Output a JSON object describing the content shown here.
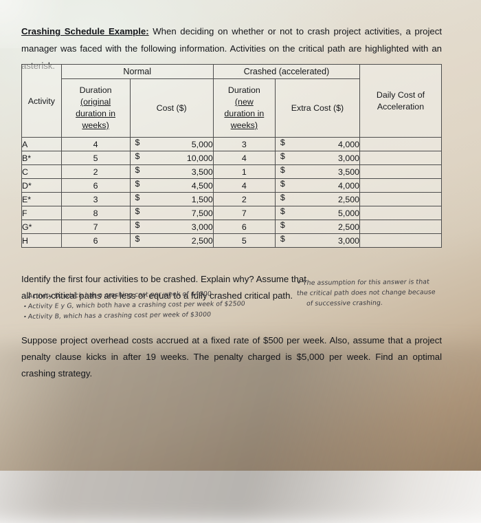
{
  "intro": {
    "lead": "Crashing Schedule Example:",
    "body": " When deciding on whether or not to crash project activities, a project manager was faced with the following information. Activities on the critical path are highlighted with an asterisk."
  },
  "table": {
    "group_headers": {
      "normal": "Normal",
      "crashed": "Crashed (accelerated)"
    },
    "columns": {
      "activity": "Activity",
      "normal_duration_line1": "Duration",
      "normal_duration_line2": "(original",
      "normal_duration_line3": "duration in",
      "normal_duration_line4": "weeks)",
      "normal_cost": "Cost ($)",
      "crashed_duration_line1": "Duration",
      "crashed_duration_line2": "(new",
      "crashed_duration_line3": "duration in",
      "crashed_duration_line4": "weeks)",
      "extra_cost": "Extra Cost ($)",
      "daily_cost_line1": "Daily Cost of",
      "daily_cost_line2": "Acceleration"
    },
    "currency_symbol": "$",
    "rows": [
      {
        "activity": "A",
        "normal_duration": "4",
        "normal_cost": "5,000",
        "crashed_duration": "3",
        "extra_cost": "4,000",
        "daily_cost": ""
      },
      {
        "activity": "B*",
        "normal_duration": "5",
        "normal_cost": "10,000",
        "crashed_duration": "4",
        "extra_cost": "3,000",
        "daily_cost": ""
      },
      {
        "activity": "C",
        "normal_duration": "2",
        "normal_cost": "3,500",
        "crashed_duration": "1",
        "extra_cost": "3,500",
        "daily_cost": ""
      },
      {
        "activity": "D*",
        "normal_duration": "6",
        "normal_cost": "4,500",
        "crashed_duration": "4",
        "extra_cost": "4,000",
        "daily_cost": ""
      },
      {
        "activity": "E*",
        "normal_duration": "3",
        "normal_cost": "1,500",
        "crashed_duration": "2",
        "extra_cost": "2,500",
        "daily_cost": ""
      },
      {
        "activity": "F",
        "normal_duration": "8",
        "normal_cost": "7,500",
        "crashed_duration": "7",
        "extra_cost": "5,000",
        "daily_cost": ""
      },
      {
        "activity": "G*",
        "normal_duration": "7",
        "normal_cost": "3,000",
        "crashed_duration": "6",
        "extra_cost": "2,500",
        "daily_cost": ""
      },
      {
        "activity": "H",
        "normal_duration": "6",
        "normal_cost": "2,500",
        "crashed_duration": "5",
        "extra_cost": "3,000",
        "daily_cost": ""
      }
    ]
  },
  "questions": {
    "q1": "Identify the first four activities to be crashed. Explain why? Assume that all non-critical paths are less or equal to a fully crashed critical path.",
    "q2": "Suppose project overhead costs accrued at a fixed rate of $500 per week. Also, assume that a project penalty clause kicks in after 19 weeks. The penalty charged is $5,000 per week. Find an optimal crashing strategy."
  },
  "handwriting": {
    "bullet": "•",
    "left_notes": [
      "Activity D, which has a crashing cost per week of $4000",
      "Activity E y G, which both have a crashing cost per week of $2500",
      "Activity B, which has a crashing cost per week of $3000"
    ],
    "right_notes": [
      "• The assumption for this answer is that",
      "the critical path does not change because",
      "of successive crashing."
    ]
  }
}
